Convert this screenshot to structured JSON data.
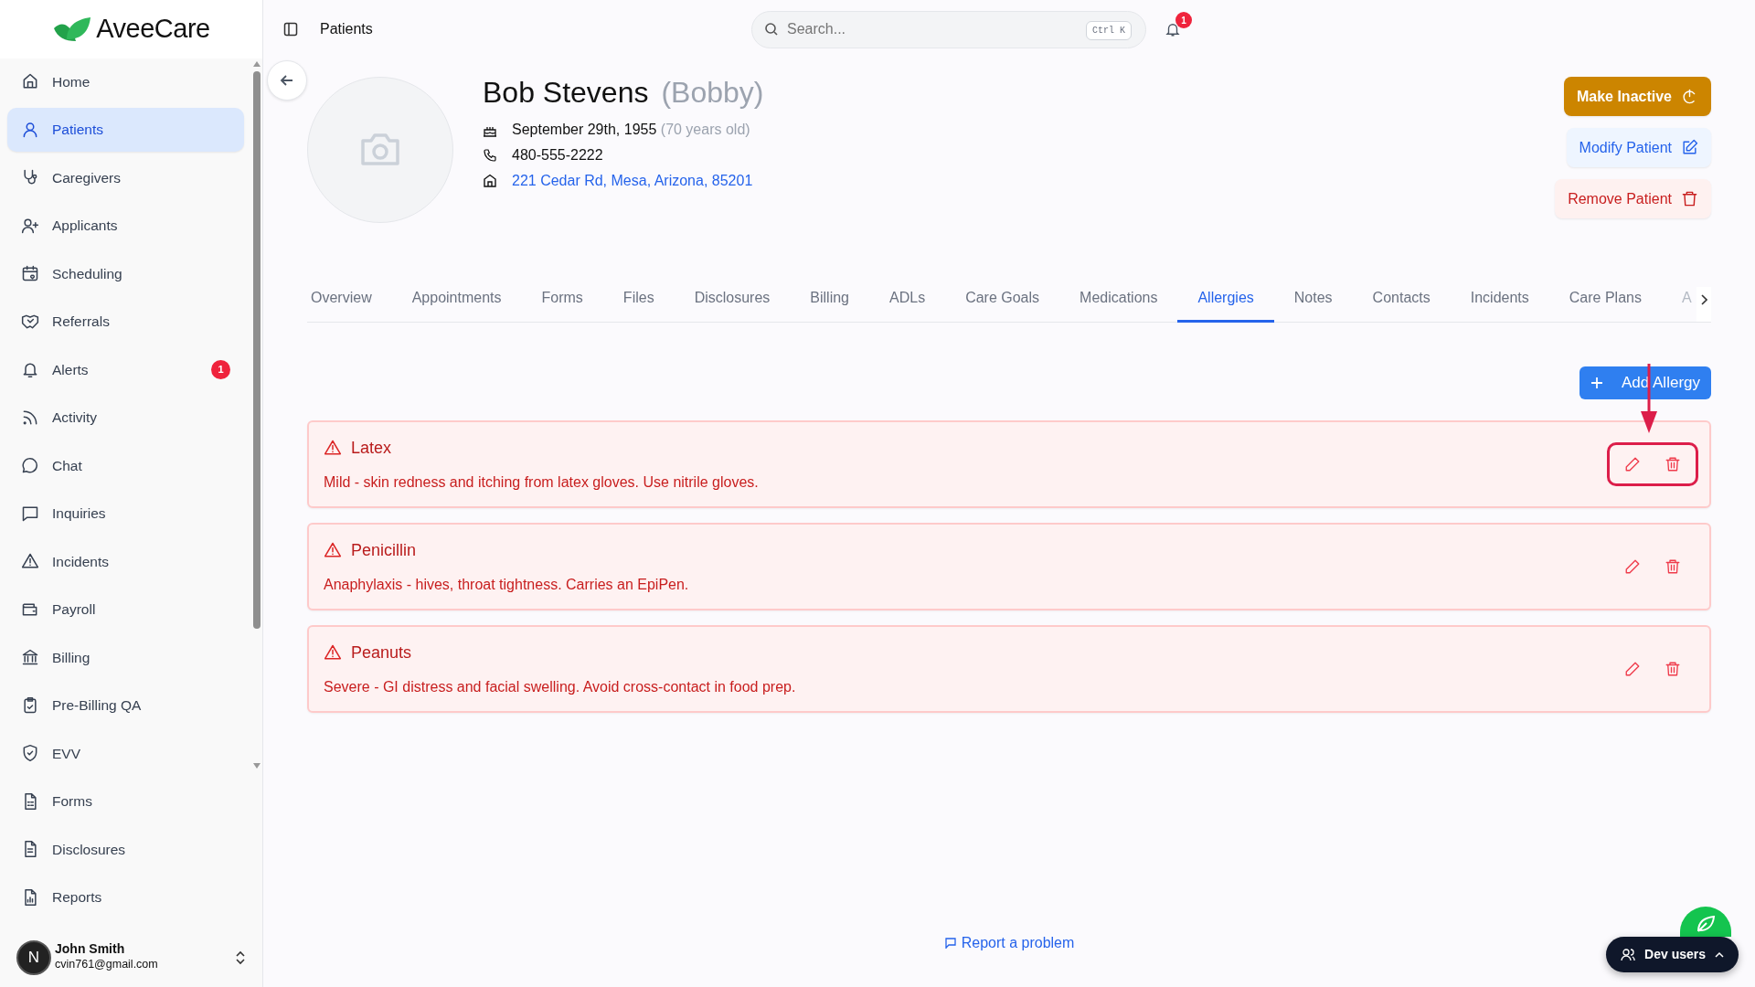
{
  "brand": "AveeCare",
  "sidebar": {
    "items": [
      {
        "label": "Home",
        "selected": false
      },
      {
        "label": "Patients",
        "selected": true
      },
      {
        "label": "Caregivers",
        "selected": false
      },
      {
        "label": "Applicants",
        "selected": false
      },
      {
        "label": "Scheduling",
        "selected": false
      },
      {
        "label": "Referrals",
        "selected": false
      },
      {
        "label": "Alerts",
        "selected": false,
        "badge": "1"
      },
      {
        "label": "Activity",
        "selected": false
      },
      {
        "label": "Chat",
        "selected": false
      },
      {
        "label": "Inquiries",
        "selected": false
      },
      {
        "label": "Incidents",
        "selected": false
      },
      {
        "label": "Payroll",
        "selected": false
      },
      {
        "label": "Billing",
        "selected": false
      },
      {
        "label": "Pre-Billing QA",
        "selected": false
      },
      {
        "label": "EVV",
        "selected": false
      },
      {
        "label": "Forms",
        "selected": false
      },
      {
        "label": "Disclosures",
        "selected": false
      },
      {
        "label": "Reports",
        "selected": false
      }
    ],
    "user": {
      "initial": "N",
      "name": "John Smith",
      "email": "cvin761@gmail.com"
    }
  },
  "header": {
    "breadcrumb": "Patients",
    "search": {
      "placeholder": "Search...",
      "shortcut": "Ctrl K"
    },
    "notifications": "1"
  },
  "patient": {
    "name": "Bob Stevens",
    "nickname": "(Bobby)",
    "birthday": "September 29th, 1955",
    "age": "(70 years old)",
    "phone": "480-555-2222",
    "address": "221 Cedar Rd, Mesa, Arizona, 85201"
  },
  "actions": [
    "Make Inactive",
    "Modify Patient",
    "Remove Patient"
  ],
  "tabs": [
    {
      "label": "Overview",
      "selected": false
    },
    {
      "label": "Appointments",
      "selected": false
    },
    {
      "label": "Forms",
      "selected": false
    },
    {
      "label": "Files",
      "selected": false
    },
    {
      "label": "Disclosures",
      "selected": false
    },
    {
      "label": "Billing",
      "selected": false
    },
    {
      "label": "ADLs",
      "selected": false
    },
    {
      "label": "Care Goals",
      "selected": false
    },
    {
      "label": "Medications",
      "selected": false
    },
    {
      "label": "Allergies",
      "selected": true
    },
    {
      "label": "Notes",
      "selected": false
    },
    {
      "label": "Contacts",
      "selected": false
    },
    {
      "label": "Incidents",
      "selected": false
    },
    {
      "label": "Care Plans",
      "selected": false
    },
    {
      "label": "A",
      "selected": false
    }
  ],
  "add_button": "Add Allergy",
  "allergies": [
    {
      "name": "Latex",
      "description": "Mild - skin redness and itching from latex gloves. Use nitrile gloves.",
      "highlighted": true
    },
    {
      "name": "Penicillin",
      "description": "Anaphylaxis - hives, throat tightness. Carries an EpiPen.",
      "highlighted": false
    },
    {
      "name": "Peanuts",
      "description": "Severe - GI distress and facial swelling. Avoid cross-contact in food prep.",
      "highlighted": false
    }
  ],
  "report_link": "Report a problem",
  "dev_users": "Dev users"
}
